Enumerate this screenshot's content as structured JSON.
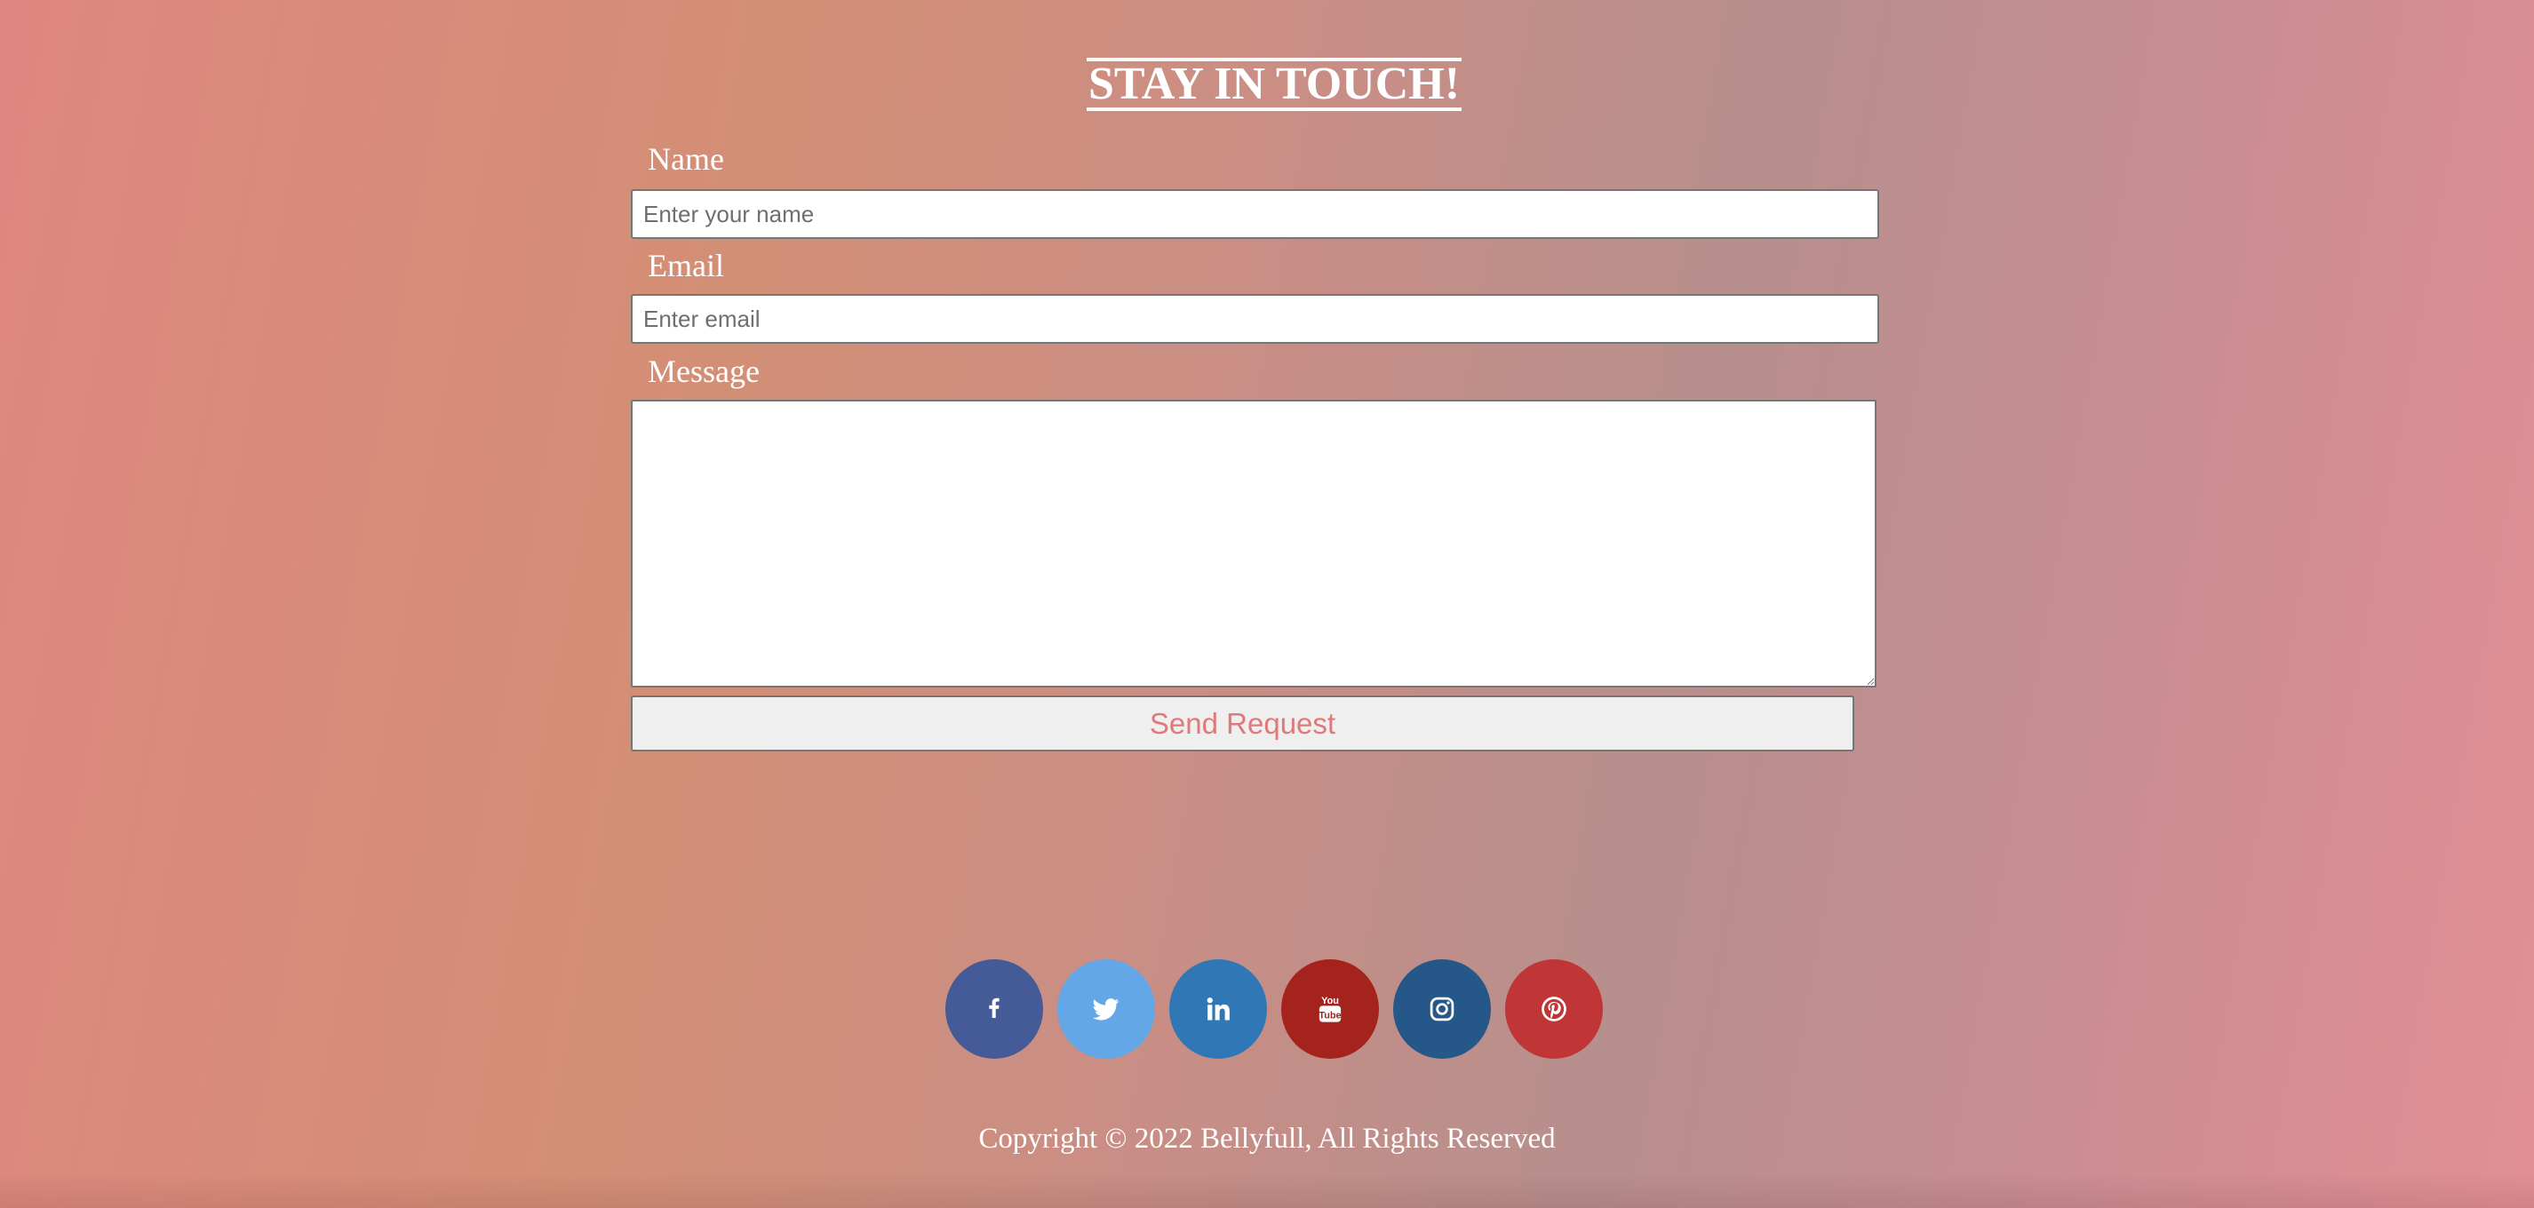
{
  "contact": {
    "title": "STAY IN TOUCH!",
    "name_label": "Name",
    "name_placeholder": "Enter your name",
    "name_value": "",
    "email_label": "Email",
    "email_placeholder": "Enter email",
    "email_value": "",
    "message_label": "Message",
    "message_value": "",
    "send_label": "Send Request"
  },
  "socials": [
    {
      "name": "facebook",
      "icon": "facebook-icon",
      "color": "#455b97"
    },
    {
      "name": "twitter",
      "icon": "twitter-icon",
      "color": "#63a7e6"
    },
    {
      "name": "linkedin",
      "icon": "linkedin-icon",
      "color": "#2f78b5"
    },
    {
      "name": "youtube",
      "icon": "youtube-icon",
      "color": "#a4231d"
    },
    {
      "name": "instagram",
      "icon": "instagram-icon",
      "color": "#265789"
    },
    {
      "name": "pinterest",
      "icon": "pinterest-icon",
      "color": "#c03535"
    }
  ],
  "footer": {
    "copyright": "Copyright © 2022 Bellyfull, All Rights Reserved"
  }
}
